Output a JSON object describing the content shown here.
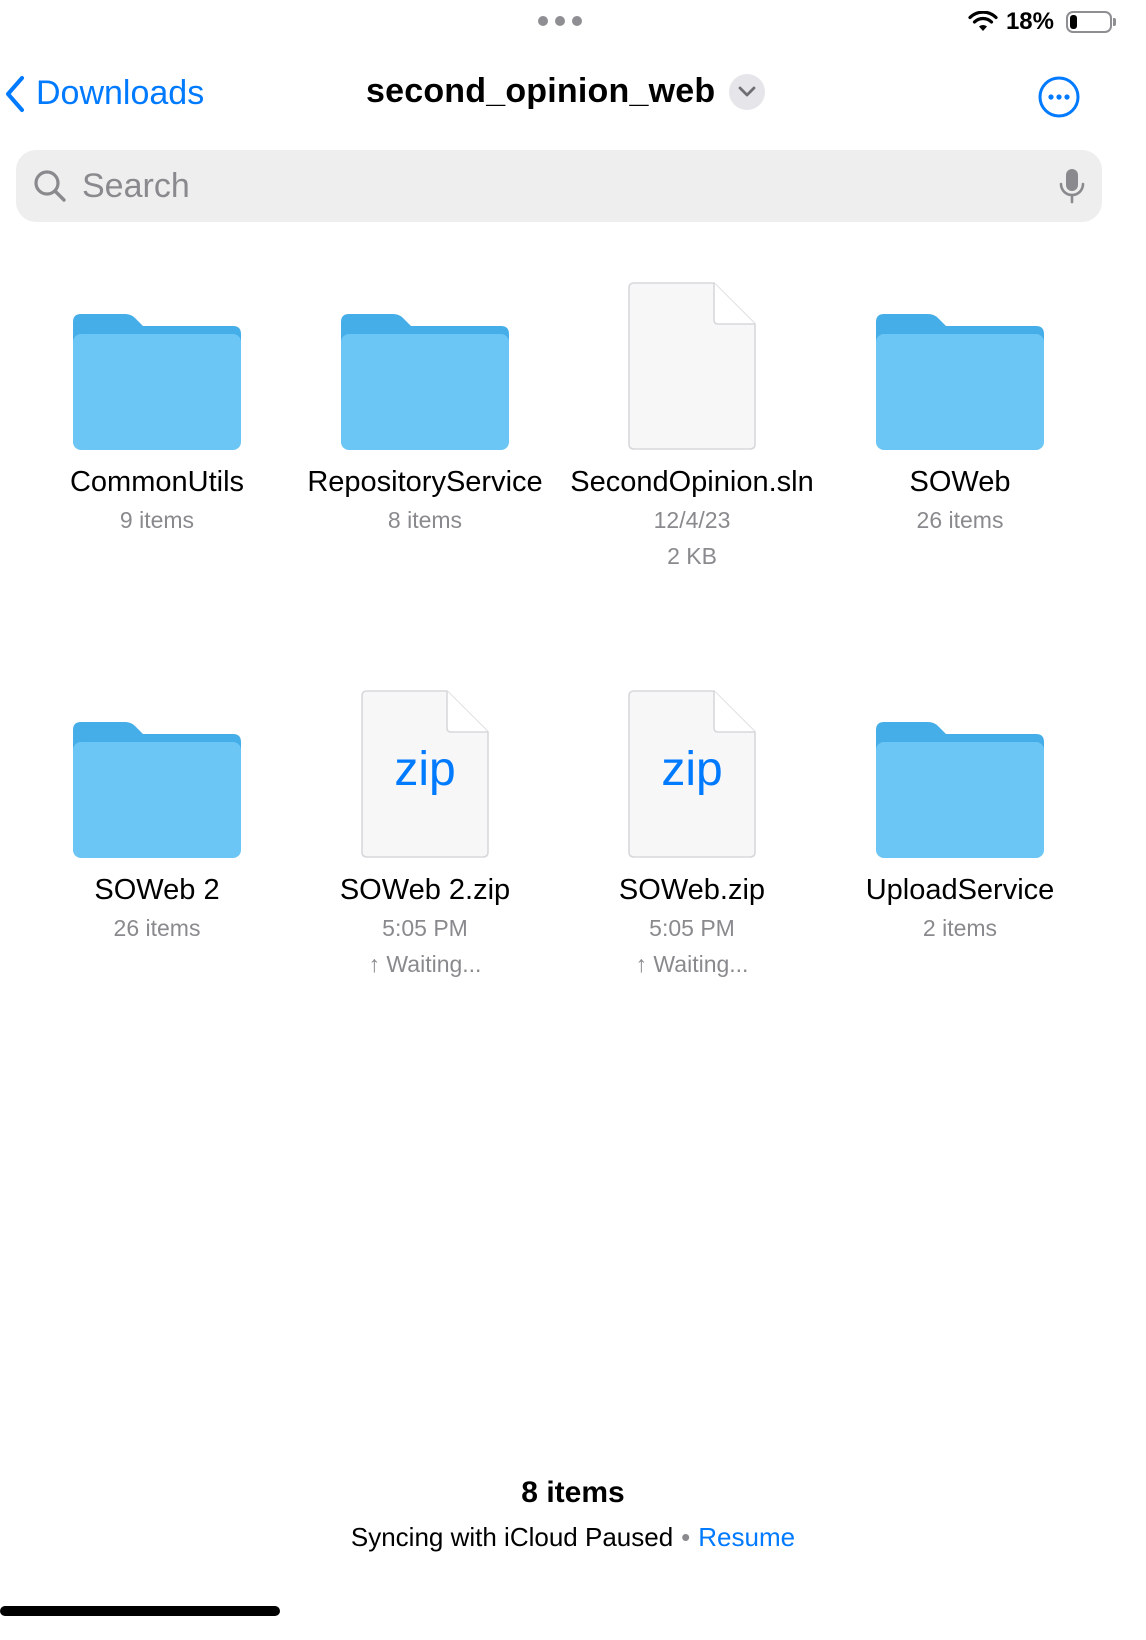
{
  "status_bar": {
    "battery_percent": "18%",
    "battery_level": 0.18
  },
  "nav": {
    "back_label": "Downloads",
    "title": "second_opinion_web"
  },
  "search": {
    "placeholder": "Search"
  },
  "items": [
    {
      "name": "CommonUtils",
      "kind": "folder",
      "meta": [
        "9 items"
      ]
    },
    {
      "name": "RepositoryService",
      "kind": "folder",
      "meta": [
        "8 items"
      ]
    },
    {
      "name": "SecondOpinion.sln",
      "kind": "file",
      "meta": [
        "12/4/23",
        "2 KB"
      ]
    },
    {
      "name": "SOWeb",
      "kind": "folder",
      "meta": [
        "26 items"
      ]
    },
    {
      "name": "SOWeb 2",
      "kind": "folder",
      "meta": [
        "26 items"
      ]
    },
    {
      "name": "SOWeb 2.zip",
      "kind": "zip",
      "icon_text": "zip",
      "meta": [
        "5:05 PM",
        "↑ Waiting..."
      ]
    },
    {
      "name": "SOWeb.zip",
      "kind": "zip",
      "icon_text": "zip",
      "meta": [
        "5:05 PM",
        "↑ Waiting..."
      ]
    },
    {
      "name": "UploadService",
      "kind": "folder",
      "meta": [
        "2 items"
      ]
    }
  ],
  "footer": {
    "count": "8 items",
    "sync_status": "Syncing with iCloud Paused",
    "resume_label": "Resume"
  },
  "colors": {
    "accent": "#007aff",
    "folder_back": "#45ade8",
    "folder_front": "#6cc6f5",
    "secondary_text": "#8a8a8e"
  }
}
